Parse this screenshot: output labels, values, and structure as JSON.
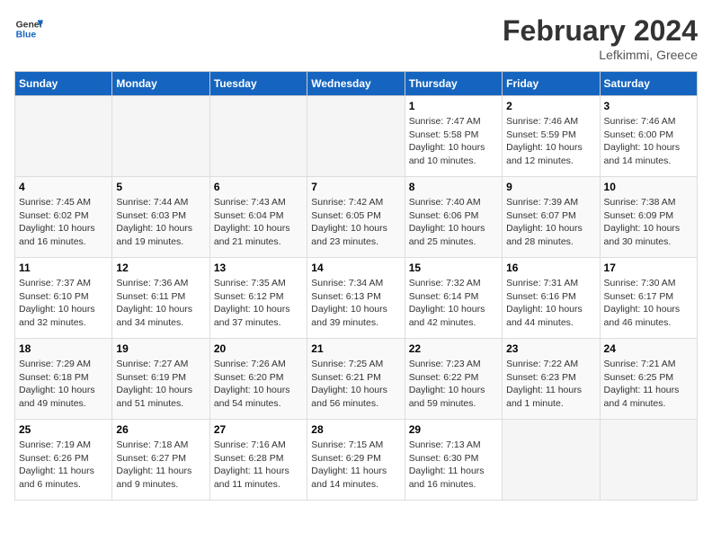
{
  "header": {
    "logo_line1": "General",
    "logo_line2": "Blue",
    "month_year": "February 2024",
    "location": "Lefkimmi, Greece"
  },
  "weekdays": [
    "Sunday",
    "Monday",
    "Tuesday",
    "Wednesday",
    "Thursday",
    "Friday",
    "Saturday"
  ],
  "weeks": [
    [
      {
        "day": "",
        "info": ""
      },
      {
        "day": "",
        "info": ""
      },
      {
        "day": "",
        "info": ""
      },
      {
        "day": "",
        "info": ""
      },
      {
        "day": "1",
        "info": "Sunrise: 7:47 AM\nSunset: 5:58 PM\nDaylight: 10 hours\nand 10 minutes."
      },
      {
        "day": "2",
        "info": "Sunrise: 7:46 AM\nSunset: 5:59 PM\nDaylight: 10 hours\nand 12 minutes."
      },
      {
        "day": "3",
        "info": "Sunrise: 7:46 AM\nSunset: 6:00 PM\nDaylight: 10 hours\nand 14 minutes."
      }
    ],
    [
      {
        "day": "4",
        "info": "Sunrise: 7:45 AM\nSunset: 6:02 PM\nDaylight: 10 hours\nand 16 minutes."
      },
      {
        "day": "5",
        "info": "Sunrise: 7:44 AM\nSunset: 6:03 PM\nDaylight: 10 hours\nand 19 minutes."
      },
      {
        "day": "6",
        "info": "Sunrise: 7:43 AM\nSunset: 6:04 PM\nDaylight: 10 hours\nand 21 minutes."
      },
      {
        "day": "7",
        "info": "Sunrise: 7:42 AM\nSunset: 6:05 PM\nDaylight: 10 hours\nand 23 minutes."
      },
      {
        "day": "8",
        "info": "Sunrise: 7:40 AM\nSunset: 6:06 PM\nDaylight: 10 hours\nand 25 minutes."
      },
      {
        "day": "9",
        "info": "Sunrise: 7:39 AM\nSunset: 6:07 PM\nDaylight: 10 hours\nand 28 minutes."
      },
      {
        "day": "10",
        "info": "Sunrise: 7:38 AM\nSunset: 6:09 PM\nDaylight: 10 hours\nand 30 minutes."
      }
    ],
    [
      {
        "day": "11",
        "info": "Sunrise: 7:37 AM\nSunset: 6:10 PM\nDaylight: 10 hours\nand 32 minutes."
      },
      {
        "day": "12",
        "info": "Sunrise: 7:36 AM\nSunset: 6:11 PM\nDaylight: 10 hours\nand 34 minutes."
      },
      {
        "day": "13",
        "info": "Sunrise: 7:35 AM\nSunset: 6:12 PM\nDaylight: 10 hours\nand 37 minutes."
      },
      {
        "day": "14",
        "info": "Sunrise: 7:34 AM\nSunset: 6:13 PM\nDaylight: 10 hours\nand 39 minutes."
      },
      {
        "day": "15",
        "info": "Sunrise: 7:32 AM\nSunset: 6:14 PM\nDaylight: 10 hours\nand 42 minutes."
      },
      {
        "day": "16",
        "info": "Sunrise: 7:31 AM\nSunset: 6:16 PM\nDaylight: 10 hours\nand 44 minutes."
      },
      {
        "day": "17",
        "info": "Sunrise: 7:30 AM\nSunset: 6:17 PM\nDaylight: 10 hours\nand 46 minutes."
      }
    ],
    [
      {
        "day": "18",
        "info": "Sunrise: 7:29 AM\nSunset: 6:18 PM\nDaylight: 10 hours\nand 49 minutes."
      },
      {
        "day": "19",
        "info": "Sunrise: 7:27 AM\nSunset: 6:19 PM\nDaylight: 10 hours\nand 51 minutes."
      },
      {
        "day": "20",
        "info": "Sunrise: 7:26 AM\nSunset: 6:20 PM\nDaylight: 10 hours\nand 54 minutes."
      },
      {
        "day": "21",
        "info": "Sunrise: 7:25 AM\nSunset: 6:21 PM\nDaylight: 10 hours\nand 56 minutes."
      },
      {
        "day": "22",
        "info": "Sunrise: 7:23 AM\nSunset: 6:22 PM\nDaylight: 10 hours\nand 59 minutes."
      },
      {
        "day": "23",
        "info": "Sunrise: 7:22 AM\nSunset: 6:23 PM\nDaylight: 11 hours\nand 1 minute."
      },
      {
        "day": "24",
        "info": "Sunrise: 7:21 AM\nSunset: 6:25 PM\nDaylight: 11 hours\nand 4 minutes."
      }
    ],
    [
      {
        "day": "25",
        "info": "Sunrise: 7:19 AM\nSunset: 6:26 PM\nDaylight: 11 hours\nand 6 minutes."
      },
      {
        "day": "26",
        "info": "Sunrise: 7:18 AM\nSunset: 6:27 PM\nDaylight: 11 hours\nand 9 minutes."
      },
      {
        "day": "27",
        "info": "Sunrise: 7:16 AM\nSunset: 6:28 PM\nDaylight: 11 hours\nand 11 minutes."
      },
      {
        "day": "28",
        "info": "Sunrise: 7:15 AM\nSunset: 6:29 PM\nDaylight: 11 hours\nand 14 minutes."
      },
      {
        "day": "29",
        "info": "Sunrise: 7:13 AM\nSunset: 6:30 PM\nDaylight: 11 hours\nand 16 minutes."
      },
      {
        "day": "",
        "info": ""
      },
      {
        "day": "",
        "info": ""
      }
    ]
  ]
}
